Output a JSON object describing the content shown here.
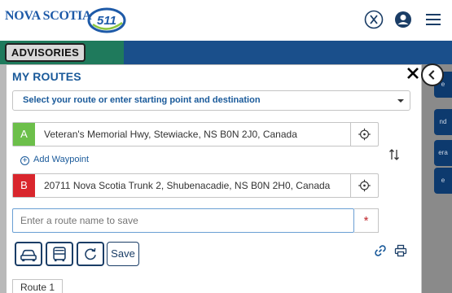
{
  "header": {
    "logo_text": "NOVA SCOTIA",
    "logo_511": "511",
    "icons": [
      "x-social-icon",
      "user-account-icon",
      "hamburger-menu-icon"
    ]
  },
  "toolbar": {
    "advisories_label": "ADVISORIES"
  },
  "map_side_chips": [
    "e",
    "nd",
    "era",
    "e"
  ],
  "panel": {
    "title": "MY ROUTES",
    "route_select_value": "Select your route or enter starting point and destination",
    "waypoints": [
      {
        "letter": "A",
        "value": "Veteran's Memorial Hwy, Stewiacke, NS B0N 2J0, Canada"
      },
      {
        "letter": "B",
        "value": "20711 Nova Scotia Trunk 2, Shubenacadie, NS B0N 2H0, Canada"
      }
    ],
    "add_waypoint_label": "Add Waypoint",
    "route_name_placeholder": "Enter a route name to save",
    "required_marker": "*",
    "save_label": "Save",
    "route_tab_label": "Route 1"
  },
  "colors": {
    "brand_blue": "#1a5a9a",
    "header_bar": "#1a4f8b",
    "advisory_tab": "#1f7a5c",
    "waypoint_a": "#6cbf4a",
    "waypoint_b": "#d9262d"
  }
}
